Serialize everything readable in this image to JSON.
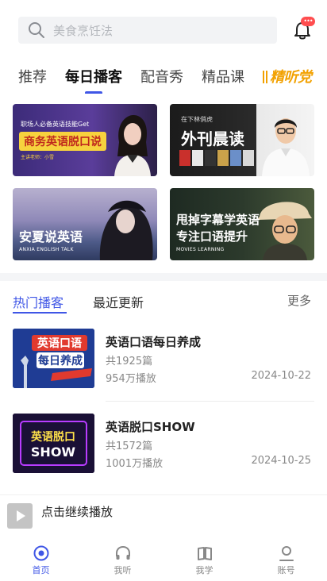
{
  "search": {
    "placeholder": "美食烹饪法"
  },
  "notifications": {
    "badge": "•••"
  },
  "tabs": [
    {
      "label": "推荐"
    },
    {
      "label": "每日播客"
    },
    {
      "label": "配音秀"
    },
    {
      "label": "精品课"
    },
    {
      "label": "精听党"
    }
  ],
  "banners": {
    "b1": {
      "kicker": "职场人必备英语技能Get",
      "title": "商务英语脱口说",
      "meta": "主讲老师：小雪"
    },
    "b2": {
      "small": "在下林俏虎",
      "title": "外刊晨读"
    },
    "b3": {
      "title": "安夏说英语",
      "sub": "ANXIA ENGLISH TALK"
    },
    "b4": {
      "title_line1": "甩掉字幕学英语",
      "title_line2": "专注口语提升",
      "sub": "MOVIES LEARNING"
    }
  },
  "section": {
    "hot": "热门播客",
    "recent": "最近更新",
    "more": "更多"
  },
  "podcasts": [
    {
      "name": "英语口语每日养成",
      "count": "共1925篇",
      "plays": "954万播放",
      "date": "2024-10-22",
      "cover_text1": "英语口语",
      "cover_text2": "每日养成"
    },
    {
      "name": "英语脱口SHOW",
      "count": "共1572篇",
      "plays": "1001万播放",
      "date": "2024-10-25",
      "cover_text1": "英语脱口",
      "cover_text2": "SHOW"
    }
  ],
  "player": {
    "label": "点击继续播放"
  },
  "nav": [
    {
      "label": "首页"
    },
    {
      "label": "我听"
    },
    {
      "label": "我学"
    },
    {
      "label": "账号"
    }
  ],
  "colors": {
    "accent": "#3f56e6",
    "badge": "#ff4d4f",
    "promo": "#f2a100"
  }
}
